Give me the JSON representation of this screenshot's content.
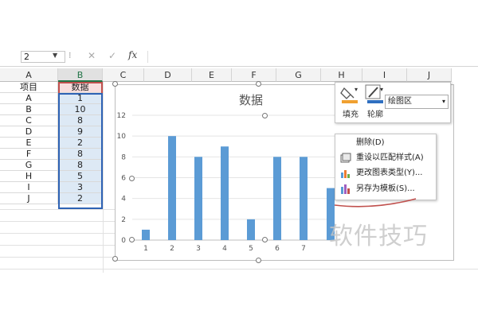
{
  "formula_bar": {
    "name_box": "2",
    "cancel_glyph": "✕",
    "enter_glyph": "✓",
    "fx_label": "fx",
    "dots": "⁝"
  },
  "columns": [
    "A",
    "B",
    "C",
    "D",
    "E",
    "F",
    "G",
    "H",
    "I",
    "J"
  ],
  "table": {
    "header": [
      "项目",
      "数据"
    ],
    "rows": [
      [
        "A",
        "1"
      ],
      [
        "B",
        "10"
      ],
      [
        "C",
        "8"
      ],
      [
        "D",
        "9"
      ],
      [
        "E",
        "2"
      ],
      [
        "F",
        "8"
      ],
      [
        "G",
        "8"
      ],
      [
        "H",
        "5"
      ],
      [
        "I",
        "3"
      ],
      [
        "J",
        "2"
      ]
    ]
  },
  "chart_data": {
    "type": "bar",
    "title": "数据",
    "categories": [
      "1",
      "2",
      "3",
      "4",
      "5",
      "6",
      "7"
    ],
    "values": [
      1,
      10,
      8,
      9,
      2,
      8,
      8
    ],
    "partially_visible_value": 5,
    "yticks": [
      "0",
      "2",
      "4",
      "6",
      "8",
      "10",
      "12"
    ],
    "ylim": [
      0,
      12
    ],
    "bar_color": "#5b9bd5",
    "gridlines": true,
    "legend": "none"
  },
  "format_popup": {
    "fill_label": "填充",
    "outline_label": "轮廓",
    "dropdown_value": "绘图区"
  },
  "context_menu": {
    "items": [
      "删除(D)",
      "重设以匹配样式(A)",
      "更改图表类型(Y)...",
      "另存为模板(S)..."
    ]
  },
  "watermark": "软件技巧",
  "colors": {
    "fill_accent": "#f0a030",
    "outline_accent": "#2f6fc0",
    "selection_red": "#c0504d",
    "selection_blue": "#2e62b4",
    "annotation_red": "#c0504d"
  }
}
